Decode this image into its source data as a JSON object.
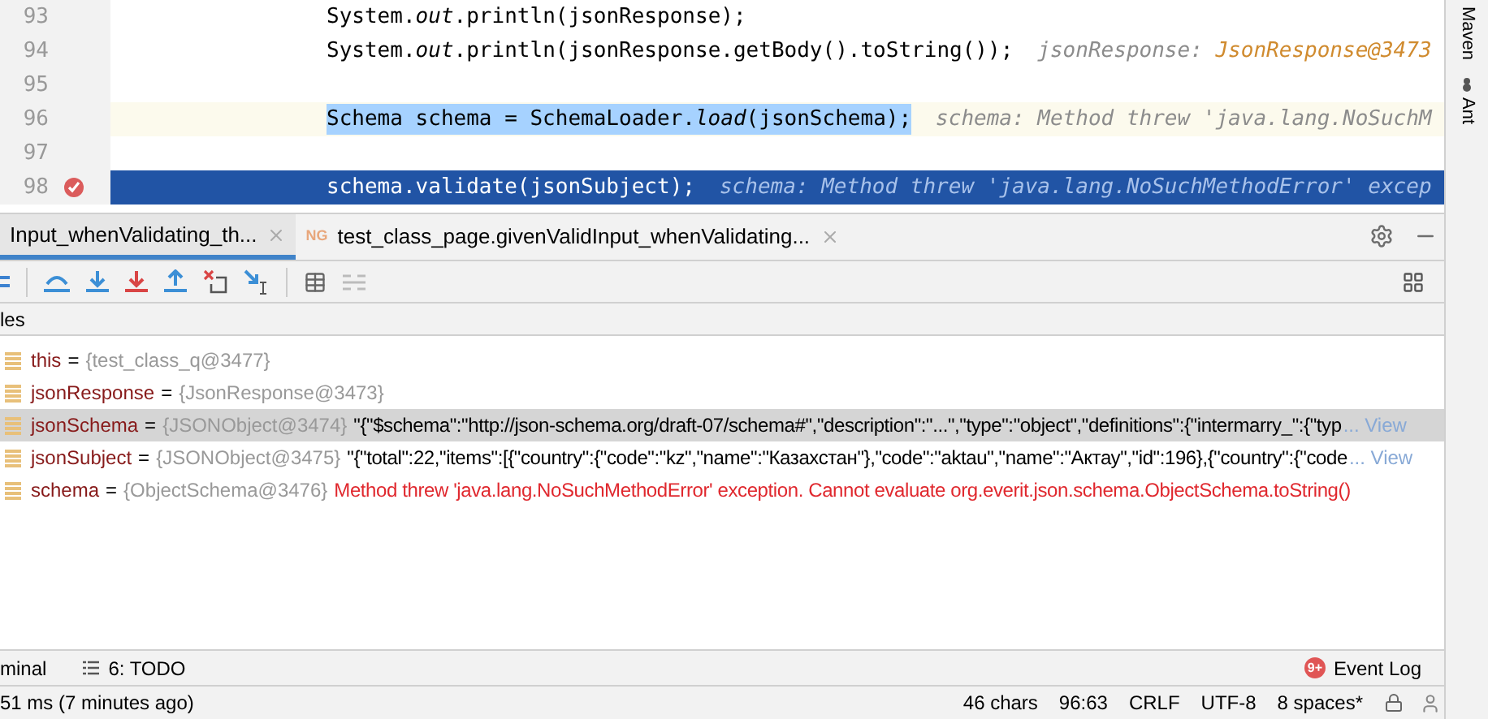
{
  "editor": {
    "lines": [
      {
        "number": "93",
        "code": "System.*out*.println(jsonResponse);",
        "breakpoint": false,
        "current": false,
        "selection": false
      },
      {
        "number": "94",
        "code": "System.*out*.println(jsonResponse.getBody().toString());",
        "hint": [
          {
            "text": "jsonResponse: ",
            "kind": "name"
          },
          {
            "text": "JsonResponse@3473",
            "kind": "value"
          }
        ],
        "breakpoint": false,
        "current": false,
        "selection": false
      },
      {
        "number": "95",
        "breakpoint": false,
        "current": false,
        "selection": false
      },
      {
        "number": "96",
        "code": "Schema schema = SchemaLoader.*load*(jsonSchema);",
        "hint": [
          {
            "text": "schema: Method threw 'java.lang.NoSuchM",
            "kind": "name"
          }
        ],
        "breakpoint": false,
        "current": false,
        "selection": true
      },
      {
        "number": "97",
        "breakpoint": false,
        "current": false,
        "selection": false
      },
      {
        "number": "98",
        "code": "schema.validate(jsonSubject);",
        "hint": [
          {
            "text": "schema: Method threw 'java.lang.NoSuchMethodError' excep",
            "kind": "name"
          }
        ],
        "breakpoint": true,
        "current": true,
        "selection": false
      }
    ]
  },
  "right_sidebar": [
    {
      "label": "Maven",
      "kind": "maven"
    },
    {
      "label": "Ant",
      "kind": "ant"
    }
  ],
  "debug_tabs": [
    {
      "label": "Input_whenValidating_th...",
      "selected": true
    },
    {
      "label": "test_class_page.givenValidInput_whenValidating...",
      "icon_text": "NG",
      "selected": false
    }
  ],
  "variables_header": "les",
  "variables": [
    {
      "name": "this",
      "separator": "=",
      "type": "{test_class_q@3477}",
      "selected": false
    },
    {
      "name": "jsonResponse",
      "separator": "=",
      "type": "{JsonResponse@3473}",
      "selected": false
    },
    {
      "name": "jsonSchema",
      "separator": "=",
      "type": "{JSONObject@3474}",
      "value": "\"{\"$schema\":\"http://json-schema.org/draft-07/schema#\",\"description\":\"...\",\"type\":\"object\",\"definitions\":{\"intermarry_\":{\"typ",
      "kind": "string",
      "link": "... View",
      "selected": true
    },
    {
      "name": "jsonSubject",
      "separator": "=",
      "type": "{JSONObject@3475}",
      "value": "\"{\"total\":22,\"items\":[{\"country\":{\"code\":\"kz\",\"name\":\"Казахстан\"},\"code\":\"aktau\",\"name\":\"Актау\",\"id\":196},{\"country\":{\"code",
      "kind": "string",
      "link": "... View",
      "selected": false
    },
    {
      "name": "schema",
      "separator": "=",
      "type": "{ObjectSchema@3476}",
      "value": "Method threw 'java.lang.NoSuchMethodError' exception. Cannot evaluate org.everit.json.schema.ObjectSchema.toString()",
      "kind": "error",
      "selected": false
    }
  ],
  "tool_windows": [
    {
      "label": "minal",
      "kind": "plain"
    },
    {
      "label": "6: TODO",
      "kind": "todo"
    }
  ],
  "event_log": {
    "badge": "9+",
    "label": "Event Log"
  },
  "status_bar": {
    "message": "51 ms (7 minutes ago)",
    "items": [
      "46 chars",
      "96:63",
      "CRLF",
      "UTF-8",
      "8 spaces*"
    ]
  }
}
